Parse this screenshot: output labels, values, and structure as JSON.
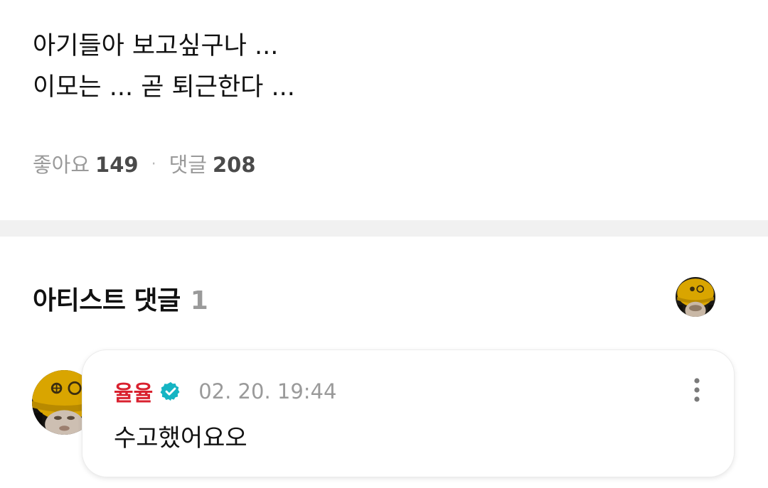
{
  "post": {
    "lines": [
      "아기들아 보고싶구나 ...",
      "이모는 ... 곧 퇴근한다 ..."
    ],
    "likes_label": "좋아요",
    "likes_count": "149",
    "separator": "·",
    "comments_label": "댓글",
    "comments_count": "208"
  },
  "artist_comments": {
    "title": "아티스트 댓글",
    "count": "1",
    "items": [
      {
        "author": "율율",
        "verified": true,
        "time": "02. 20. 19:44",
        "text": "수고했어요오"
      }
    ]
  },
  "colors": {
    "author_red": "#d9212f",
    "verified_teal": "#15b4c3",
    "muted_gray": "#9a9a9a",
    "beanie_yellow": "#d9a500"
  },
  "icons": {
    "verified": "verified-badge-icon",
    "more": "more-vertical-icon"
  }
}
